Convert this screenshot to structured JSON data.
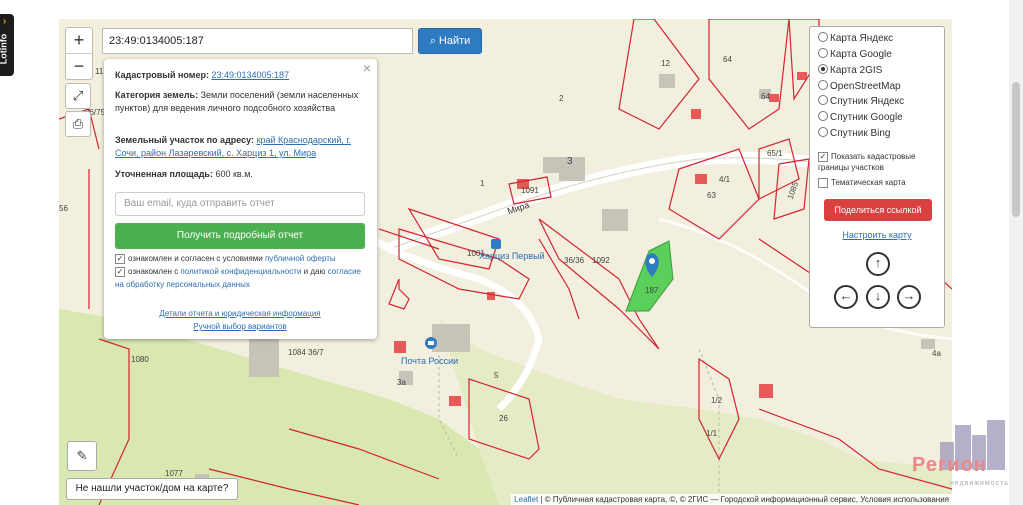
{
  "sidebar_tab": {
    "label": "Lotinfo",
    "arrow": "›"
  },
  "search": {
    "value": "23:49:0134005:187",
    "button_label": "Найти"
  },
  "zoom": {
    "plus": "+",
    "minus": "−"
  },
  "popup": {
    "close": "×",
    "cadastral_label": "Кадастровый номер:",
    "cadastral_value": "23:49:0134005:187",
    "category_label": "Категория земель:",
    "category_value": "Земли поселений (земли населенных пунктов) для ведения личного подсобного хозяйства",
    "address_label": "Земельный участок по адресу:",
    "address_value": "край Краснодарский, г. Сочи, район Лазаревский, с. Харциз 1, ул. Мира",
    "area_label": "Уточненная площадь:",
    "area_value": "600 кв.м.",
    "email_placeholder": "Ваш email, куда отправить отчет",
    "report_button": "Получить подробный отчет",
    "consent1_text": "ознакомлен и согласен с условиями ",
    "consent1_link": "публичной оферты",
    "consent2_text": "ознакомлен с ",
    "consent2_link": "политикой конфиденциальности",
    "consent2_mid": " и даю ",
    "consent2_link2": "согласие на обработку персональных данных",
    "details_link": "Детали отчета и юридическая информация",
    "manual_link": "Ручной выбор вариантов"
  },
  "layers": {
    "options": [
      {
        "label": "Карта Яндекс",
        "selected": false
      },
      {
        "label": "Карта Google",
        "selected": false
      },
      {
        "label": "Карта 2GIS",
        "selected": true
      },
      {
        "label": "OpenStreetMap",
        "selected": false
      },
      {
        "label": "Спутник Яндекс",
        "selected": false
      },
      {
        "label": "Спутник Google",
        "selected": false
      },
      {
        "label": "Спутник Bing",
        "selected": false
      }
    ],
    "show_borders": "Показать кадастровые границы участков",
    "thematic": "Тематическая карта",
    "share_button": "Поделиться ссылкой",
    "customize_link": "Настроить карту"
  },
  "map": {
    "street": "Мира",
    "poi_post": "Почта России",
    "poi_bus": "Харциз Первый",
    "parcel_selected": "187",
    "labels": [
      "12",
      "64",
      "64",
      "2",
      "3",
      "1",
      "1091",
      "65/1",
      "63",
      "4/1",
      "1085",
      "36/36",
      "1092",
      "1001",
      "1080",
      "1084 36/7",
      "3а",
      "5",
      "26",
      "1/2",
      "1/1",
      "4а",
      "11",
      "36/75",
      "56",
      "1077",
      "2",
      "2"
    ]
  },
  "not_found": "Не нашли участок/дом на карте?",
  "attribution": {
    "leaflet": "Leaflet",
    "text": " | © Публичная кадастровая карта, ©, © 2ГИС — Городской информационный сервис, Условия использования"
  },
  "logo": {
    "name": "Регион",
    "sub": "недвижимость"
  },
  "colors": {
    "parcel_border": "#d42430",
    "selected_parcel": "#5ad05a",
    "button_blue": "#2f7bc2",
    "button_green": "#4caf50",
    "button_red": "#d94040"
  }
}
